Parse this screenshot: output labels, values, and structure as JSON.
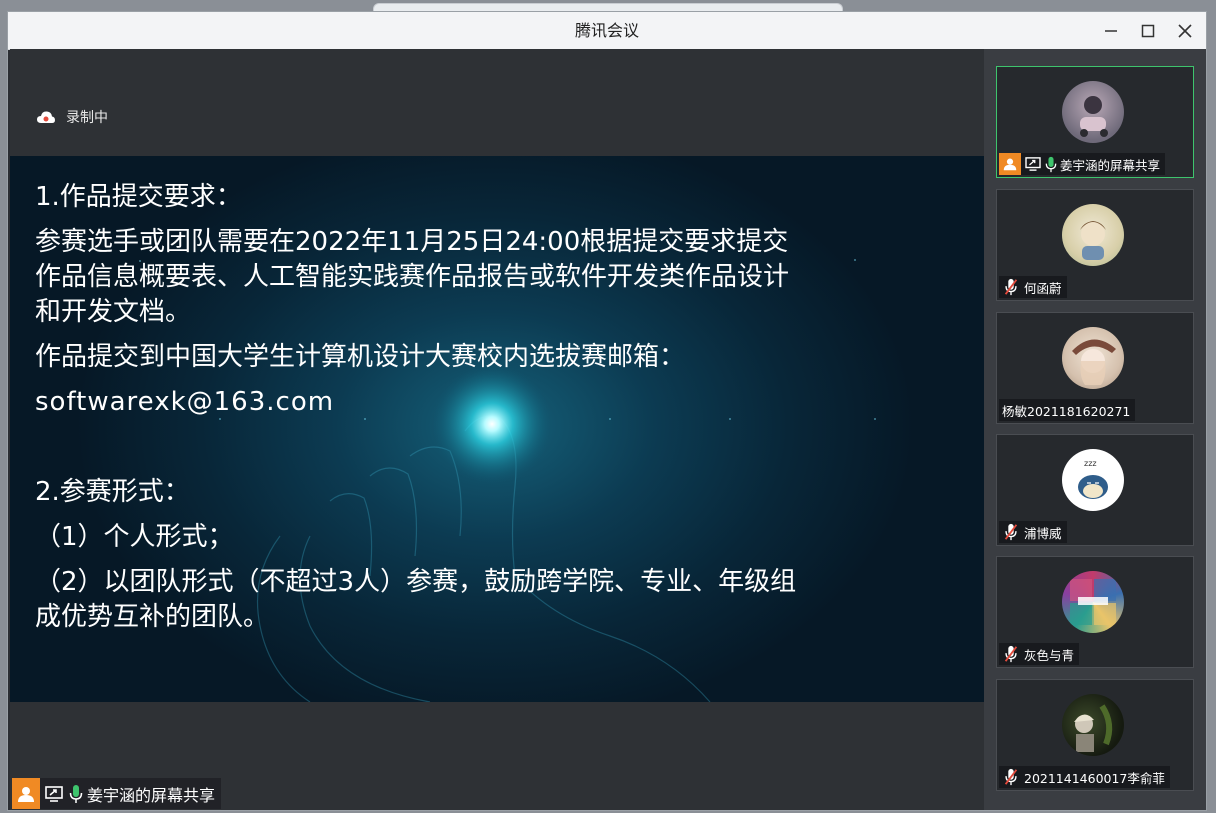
{
  "window": {
    "title": "腾讯会议"
  },
  "recording": {
    "label": "录制中"
  },
  "slide": {
    "lines": [
      "1.作品提交要求：",
      "参赛选手或团队需要在2022年11月25日24:00根据提交要求提交",
      "作品信息概要表、人工智能实践赛作品报告或软件开发类作品设计",
      "和开发文档。",
      "作品提交到中国大学生计算机设计大赛校内选拔赛邮箱：",
      "softwarexk@163.com",
      "2.参赛形式：",
      "（1）个人形式；",
      "（2）以团队形式（不超过3人）参赛，鼓励跨学院、专业、年级组",
      "成优势互补的团队。"
    ]
  },
  "share_label": {
    "text": "姜宇涵的屏幕共享"
  },
  "participants": [
    {
      "name": "姜宇涵的屏幕共享",
      "mic": "on",
      "sharing": true,
      "active": true
    },
    {
      "name": "何函蔚",
      "mic": "muted"
    },
    {
      "name": "杨敏2021181620271",
      "mic": "none"
    },
    {
      "name": "浦博威",
      "mic": "muted"
    },
    {
      "name": "灰色与青",
      "mic": "muted"
    },
    {
      "name": "2021141460017李俞菲",
      "mic": "muted"
    }
  ],
  "colors": {
    "accent_green": "#3ec46d",
    "share_orange": "#f08a24",
    "muted_red": "#e34a3c"
  },
  "icons": [
    "cloud-recording-icon",
    "minimize-icon",
    "maximize-icon",
    "close-icon",
    "person-icon",
    "screen-share-icon",
    "microphone-icon",
    "muted-microphone-icon"
  ]
}
